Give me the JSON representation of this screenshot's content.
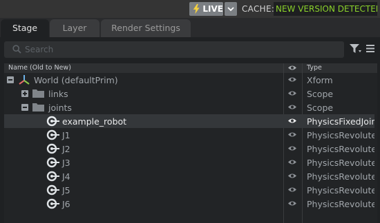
{
  "header": {
    "live_label": "LIVE",
    "cache_label": "CACHE:",
    "cache_status": "NEW VERSION DETECTED",
    "colors": {
      "live_bolt": "#f4d03f",
      "cache_status": "#8bd22b"
    }
  },
  "tabs": [
    {
      "label": "Stage",
      "active": true
    },
    {
      "label": "Layer",
      "active": false
    },
    {
      "label": "Render Settings",
      "active": false
    }
  ],
  "search": {
    "placeholder": "Search"
  },
  "tree": {
    "columns": {
      "name": "Name (Old to New)",
      "type": "Type"
    },
    "rows": [
      {
        "label": "World (defaultPrim)",
        "type": "Xform",
        "icon": "xform-icon",
        "expander": "expanded"
      },
      {
        "label": "links",
        "type": "Scope",
        "icon": "folder-icon",
        "expander": "collapsed"
      },
      {
        "label": "joints",
        "type": "Scope",
        "icon": "folder-icon",
        "expander": "expanded"
      },
      {
        "label": "example_robot",
        "type": "PhysicsFixedJoint",
        "icon": "joint-icon",
        "selected": true
      },
      {
        "label": "J1",
        "type": "PhysicsRevoluteJoint",
        "icon": "joint-icon"
      },
      {
        "label": "J2",
        "type": "PhysicsRevoluteJoint",
        "icon": "joint-icon"
      },
      {
        "label": "J3",
        "type": "PhysicsRevoluteJoint",
        "icon": "joint-icon"
      },
      {
        "label": "J4",
        "type": "PhysicsRevoluteJoint",
        "icon": "joint-icon"
      },
      {
        "label": "J5",
        "type": "PhysicsRevoluteJoint",
        "icon": "joint-icon"
      },
      {
        "label": "J6",
        "type": "PhysicsRevoluteJoint",
        "icon": "joint-icon"
      }
    ]
  }
}
